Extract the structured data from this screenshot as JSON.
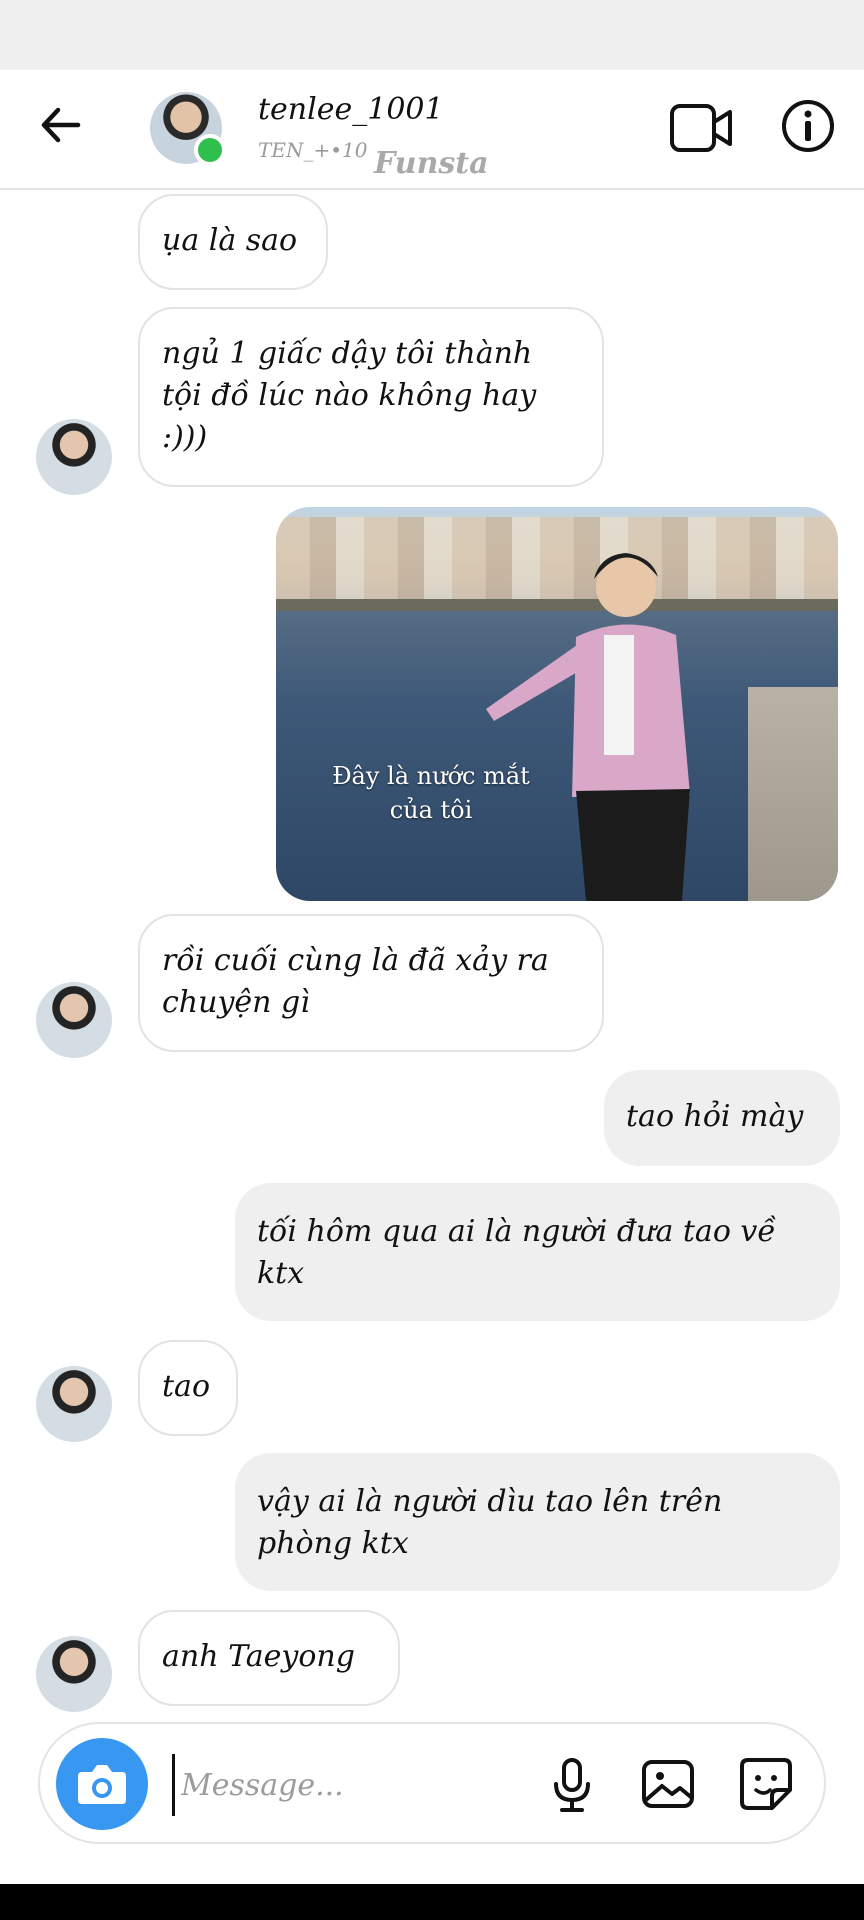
{
  "header": {
    "username": "tenlee_1001",
    "subtitle": "TEN_+•10",
    "watermark": "Funsta"
  },
  "messages": [
    {
      "side": "in",
      "text": "ụa là sao"
    },
    {
      "side": "in",
      "text": "ngủ 1 giấc dậy tôi thành tội đồ lúc nào không hay :)))"
    },
    {
      "side": "out",
      "type": "image",
      "caption": "Đây là nước mắt của tôi"
    },
    {
      "side": "in",
      "text": "rồi cuối cùng là đã xảy ra chuyện gì"
    },
    {
      "side": "out",
      "text": "tao hỏi mày"
    },
    {
      "side": "out",
      "text": "tối hôm qua ai là người đưa tao về ktx"
    },
    {
      "side": "in",
      "text": "tao"
    },
    {
      "side": "out",
      "text": "vậy ai là người dìu tao lên trên phòng ktx"
    },
    {
      "side": "in",
      "text": "anh Taeyong"
    }
  ],
  "composer": {
    "placeholder": "Message..."
  },
  "icons": {
    "back": "arrow-left-icon",
    "video": "video-camera-icon",
    "info": "info-icon",
    "camera": "camera-icon",
    "mic": "microphone-icon",
    "gallery": "image-icon",
    "sticker": "sticker-icon"
  },
  "colors": {
    "accent": "#3897f0",
    "online": "#2fbf4f",
    "outgoing_bubble": "#efefef",
    "incoming_border": "#e3e3e3"
  }
}
